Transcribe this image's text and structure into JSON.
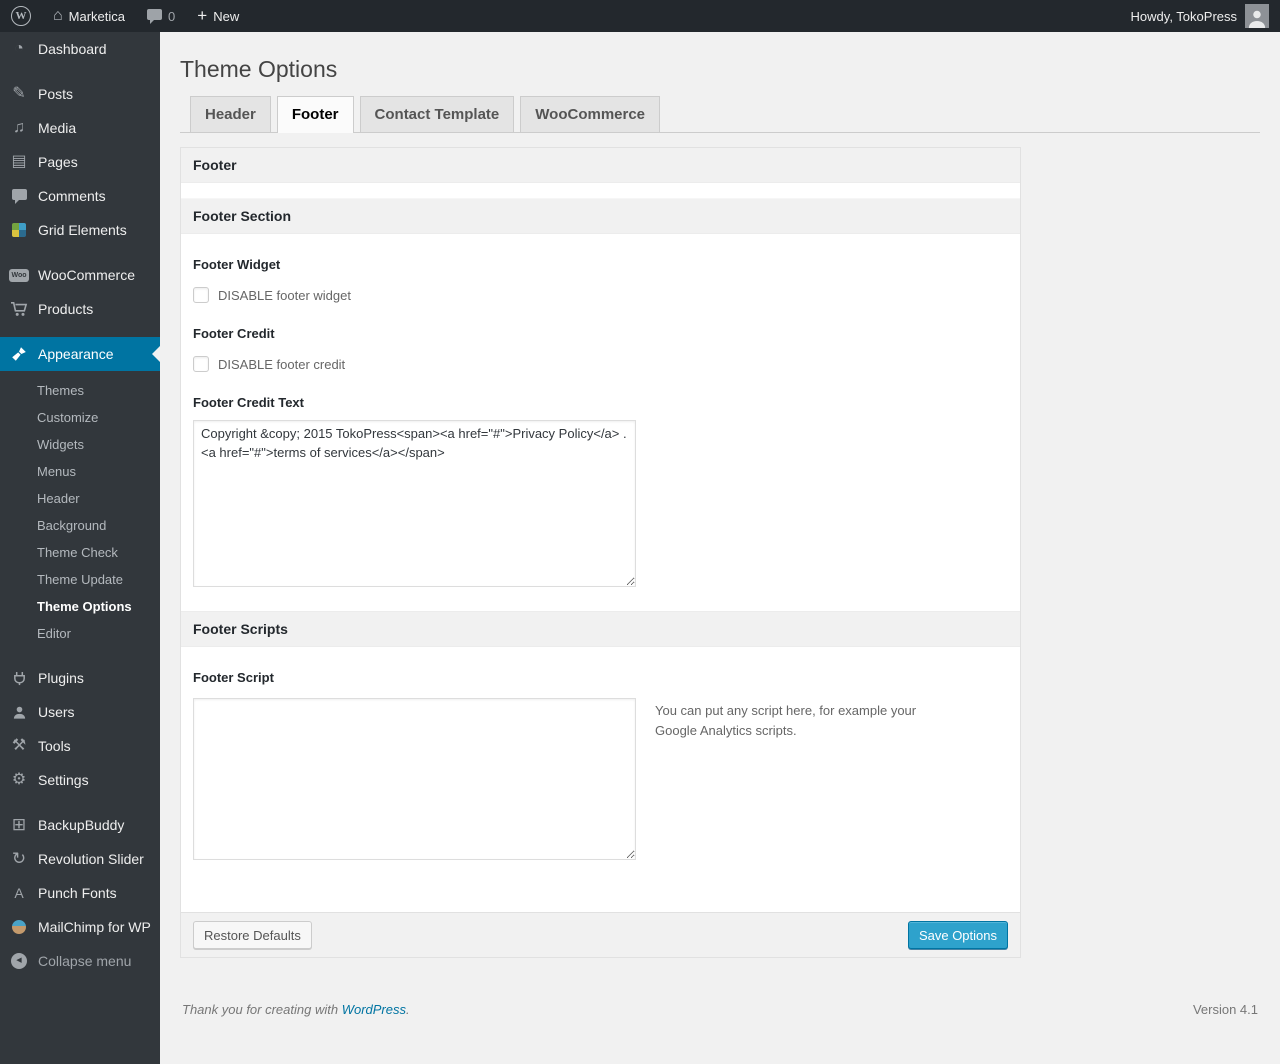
{
  "admin_bar": {
    "site_name": "Marketica",
    "comment_count": "0",
    "new_label": "New",
    "howdy_text": "Howdy, TokoPress"
  },
  "sidebar": {
    "items": [
      {
        "label": "Dashboard",
        "icon": "dashboard-icon"
      },
      {
        "label": "Posts",
        "icon": "pin-icon"
      },
      {
        "label": "Media",
        "icon": "media-icon"
      },
      {
        "label": "Pages",
        "icon": "pages-icon"
      },
      {
        "label": "Comments",
        "icon": "comment-bubble-icon"
      },
      {
        "label": "Grid Elements",
        "icon": "grid-icon"
      },
      {
        "label": "WooCommerce",
        "icon": "woo-badge-icon"
      },
      {
        "label": "Products",
        "icon": "cart-icon"
      },
      {
        "label": "Appearance",
        "icon": "brush-icon",
        "active": true
      },
      {
        "label": "Plugins",
        "icon": "plug-icon"
      },
      {
        "label": "Users",
        "icon": "person-icon"
      },
      {
        "label": "Tools",
        "icon": "tools-icon"
      },
      {
        "label": "Settings",
        "icon": "settings-icon"
      },
      {
        "label": "BackupBuddy",
        "icon": "backup-drive-icon"
      },
      {
        "label": "Revolution Slider",
        "icon": "refresh-arrows-icon"
      },
      {
        "label": "Punch Fonts",
        "icon": "letter-a-icon"
      },
      {
        "label": "MailChimp for WP",
        "icon": "mailchimp-monkey-icon"
      }
    ],
    "appearance_submenu": [
      {
        "label": "Themes"
      },
      {
        "label": "Customize"
      },
      {
        "label": "Widgets"
      },
      {
        "label": "Menus"
      },
      {
        "label": "Header"
      },
      {
        "label": "Background"
      },
      {
        "label": "Theme Check"
      },
      {
        "label": "Theme Update"
      },
      {
        "label": "Theme Options",
        "current": true
      },
      {
        "label": "Editor"
      }
    ],
    "collapse_label": "Collapse menu"
  },
  "page": {
    "title": "Theme Options",
    "tabs": [
      {
        "label": "Header"
      },
      {
        "label": "Footer",
        "active": true
      },
      {
        "label": "Contact Template"
      },
      {
        "label": "WooCommerce"
      }
    ]
  },
  "panel": {
    "title": "Footer",
    "section_title": "Footer Section",
    "footer_widget": {
      "label": "Footer Widget",
      "checkbox_label": "DISABLE footer widget",
      "checked": false
    },
    "footer_credit": {
      "label": "Footer Credit",
      "checkbox_label": "DISABLE footer credit",
      "checked": false
    },
    "footer_credit_text": {
      "label": "Footer Credit Text",
      "value": "Copyright &copy; 2015 TokoPress<span><a href=\"#\">Privacy Policy</a> . <a href=\"#\">terms of services</a></span>"
    },
    "scripts_section_title": "Footer Scripts",
    "footer_script": {
      "label": "Footer Script",
      "value": "",
      "description": "You can put any script here, for example your Google Analytics scripts."
    },
    "buttons": {
      "restore": "Restore Defaults",
      "save": "Save Options"
    }
  },
  "page_footer": {
    "thanks_prefix": "Thank you for creating with ",
    "wordpress_link_label": "WordPress",
    "thanks_suffix": ".",
    "version": "Version 4.1"
  },
  "colors": {
    "accent_blue": "#0074a2",
    "primary_button_blue": "#2ea2cc",
    "admin_bar_bg": "#23282d",
    "sidebar_bg": "#32373c",
    "page_bg": "#f1f1f1"
  }
}
